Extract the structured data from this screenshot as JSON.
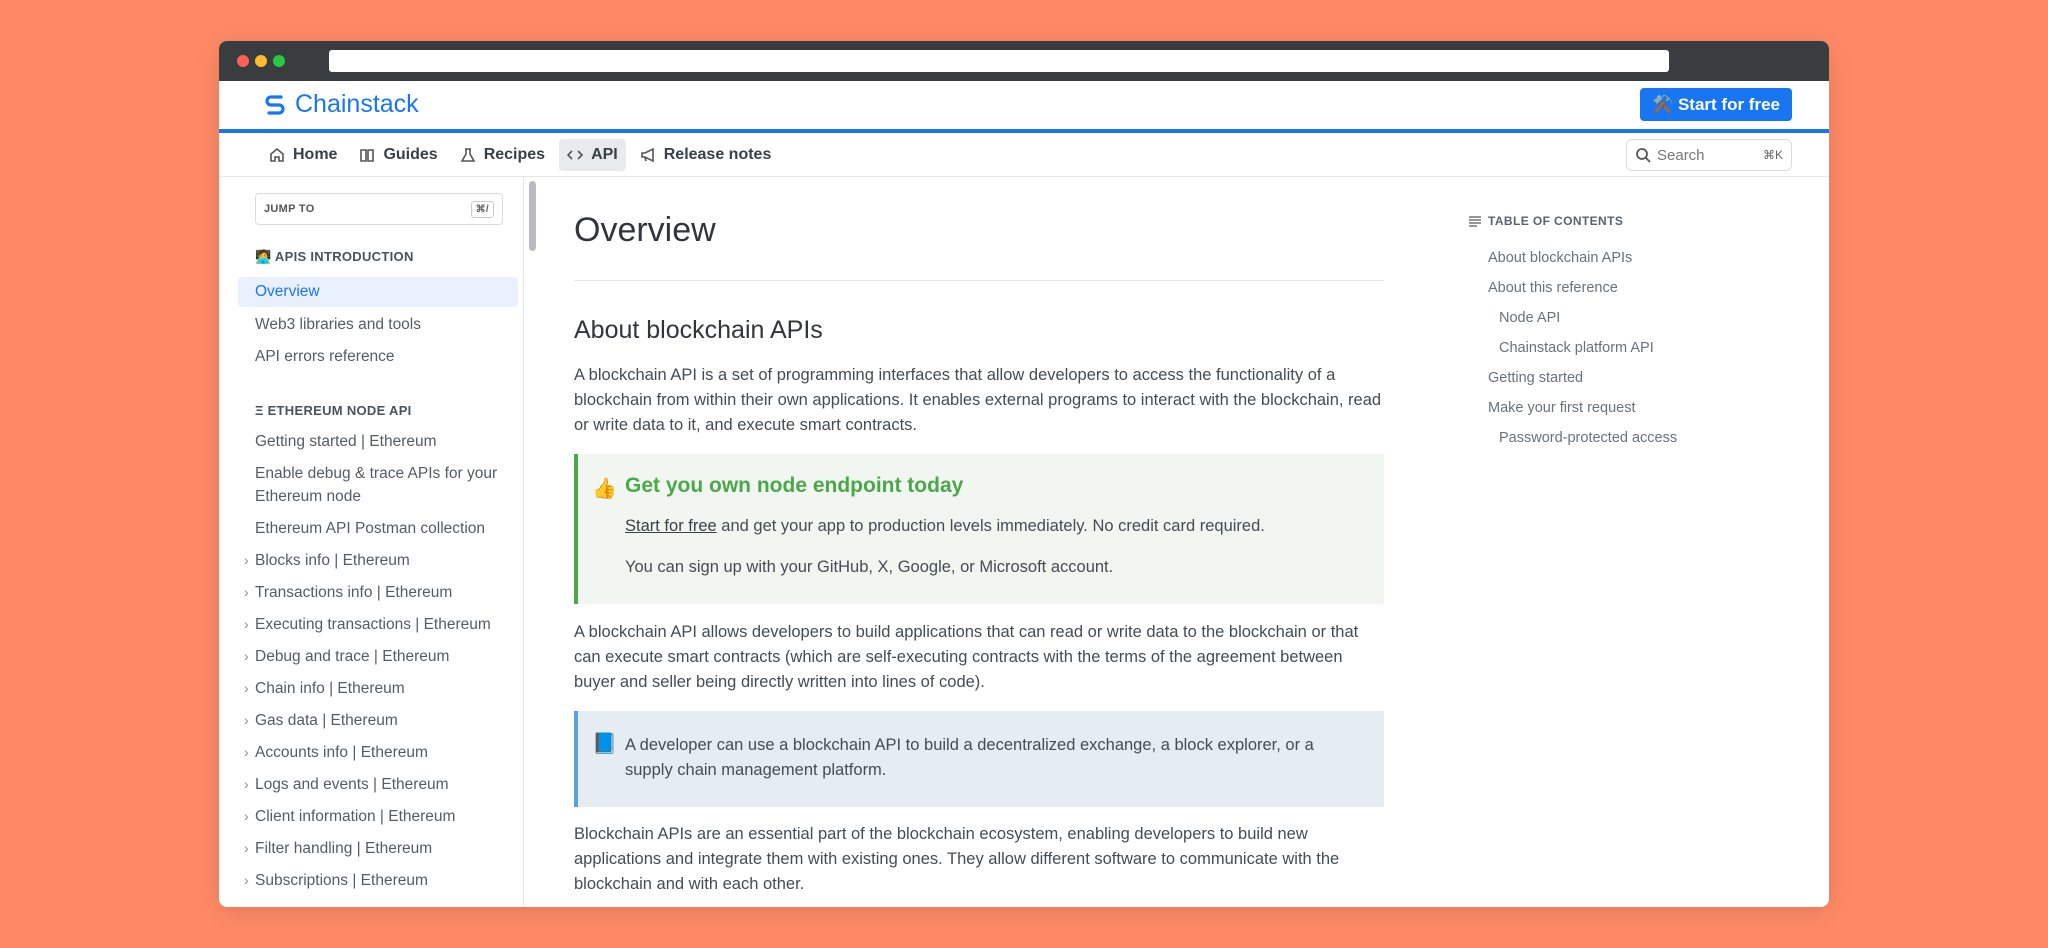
{
  "header": {
    "logo_text": "Chainstack",
    "start_button": "⚒️ Start for free"
  },
  "nav": {
    "items": [
      {
        "label": "Home",
        "icon": "home-icon"
      },
      {
        "label": "Guides",
        "icon": "book-icon"
      },
      {
        "label": "Recipes",
        "icon": "flask-icon"
      },
      {
        "label": "API",
        "icon": "code-icon",
        "active": true
      },
      {
        "label": "Release notes",
        "icon": "megaphone-icon"
      }
    ],
    "search_placeholder": "Search",
    "search_shortcut": "⌘K"
  },
  "sidebar": {
    "jump_label": "JUMP TO",
    "jump_shortcut": "⌘/",
    "section1": "🧑‍💻 APIS INTRODUCTION",
    "section1_items": [
      "Overview",
      "Web3 libraries and tools",
      "API errors reference"
    ],
    "section2": "Ξ ETHEREUM NODE API",
    "section2_items": [
      "Getting started | Ethereum",
      "Enable debug & trace APIs for your Ethereum node",
      "Ethereum API Postman collection"
    ],
    "section2_expandable": [
      "Blocks info | Ethereum",
      "Transactions info | Ethereum",
      "Executing transactions | Ethereum",
      "Debug and trace | Ethereum",
      "Chain info | Ethereum",
      "Gas data | Ethereum",
      "Accounts info | Ethereum",
      "Logs and events | Ethereum",
      "Client information | Ethereum",
      "Filter handling | Ethereum",
      "Subscriptions | Ethereum"
    ]
  },
  "main": {
    "title": "Overview",
    "h2": "About blockchain APIs",
    "para1": "A blockchain API is a set of programming interfaces that allow developers to access the functionality of a blockchain from within their own applications. It enables external programs to interact with the blockchain, read or write data to it, and execute smart contracts.",
    "callout_green": {
      "emoji": "👍",
      "title": "Get you own node endpoint today",
      "link": "Start for free",
      "line1_rest": " and get your app to production levels immediately. No credit card required.",
      "line2": "You can sign up with your GitHub, X, Google, or Microsoft account."
    },
    "para2": "A blockchain API allows developers to build applications that can read or write data to the blockchain or that can execute smart contracts (which are self-executing contracts with the terms of the agreement between buyer and seller being directly written into lines of code).",
    "callout_blue": {
      "emoji": "📘",
      "text": "A developer can use a blockchain API to build a decentralized exchange, a block explorer, or a supply chain management platform."
    },
    "para3": "Blockchain APIs are an essential part of the blockchain ecosystem, enabling developers to build new applications and integrate them with existing ones. They allow different software to communicate with the blockchain and with each other."
  },
  "toc": {
    "heading": "TABLE OF CONTENTS",
    "items": [
      {
        "label": "About blockchain APIs",
        "indent": false
      },
      {
        "label": "About this reference",
        "indent": false
      },
      {
        "label": "Node API",
        "indent": true
      },
      {
        "label": "Chainstack platform API",
        "indent": true
      },
      {
        "label": "Getting started",
        "indent": false
      },
      {
        "label": "Make your first request",
        "indent": false
      },
      {
        "label": "Password-protected access",
        "indent": true
      }
    ]
  },
  "colors": {
    "brand": "#1876F2",
    "background": "#FF8A65",
    "callout_green": "#4AA84A",
    "callout_blue": "#58A3DC"
  }
}
